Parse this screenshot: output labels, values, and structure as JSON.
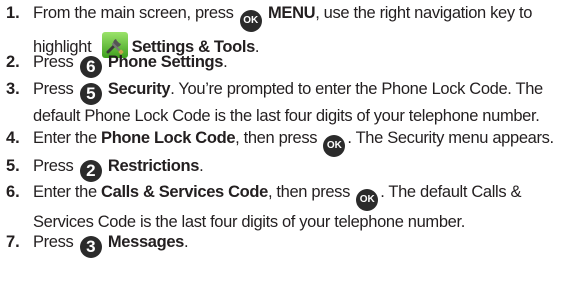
{
  "steps": [
    {
      "number": "1.",
      "line1_pre": "From the main screen, press ",
      "ok_key": "OK",
      "menu": "MENU",
      "line1_post": ", use the right navigation key to",
      "line2_pre": "highlight ",
      "settings_tools": "Settings & Tools",
      "line2_post": ".",
      "icon": "settings-tools-icon"
    },
    {
      "number": "2.",
      "pre": "Press ",
      "key": "6",
      "label": "Phone Settings",
      "post": "."
    },
    {
      "number": "3.",
      "pre": "Press ",
      "key": "5",
      "label": "Security",
      "line1_post": ". You’re prompted to enter the Phone Lock Code. The",
      "line2": "default Phone Lock Code is the last four digits of your telephone number."
    },
    {
      "number": "4.",
      "pre": "Enter the ",
      "label": "Phone Lock Code",
      "mid": ", then press ",
      "ok_key": "OK",
      "post": ". The Security menu appears."
    },
    {
      "number": "5.",
      "pre": "Press ",
      "key": "2",
      "label": "Restrictions",
      "post": "."
    },
    {
      "number": "6.",
      "pre": "Enter the ",
      "label": "Calls & Services Code",
      "mid": ", then press ",
      "ok_key": "OK",
      "line1_post": ". The default Calls &",
      "line2": "Services Code is the last four digits of your telephone number."
    },
    {
      "number": "7.",
      "pre": "Press ",
      "key": "3",
      "label": "Messages",
      "post": "."
    }
  ]
}
